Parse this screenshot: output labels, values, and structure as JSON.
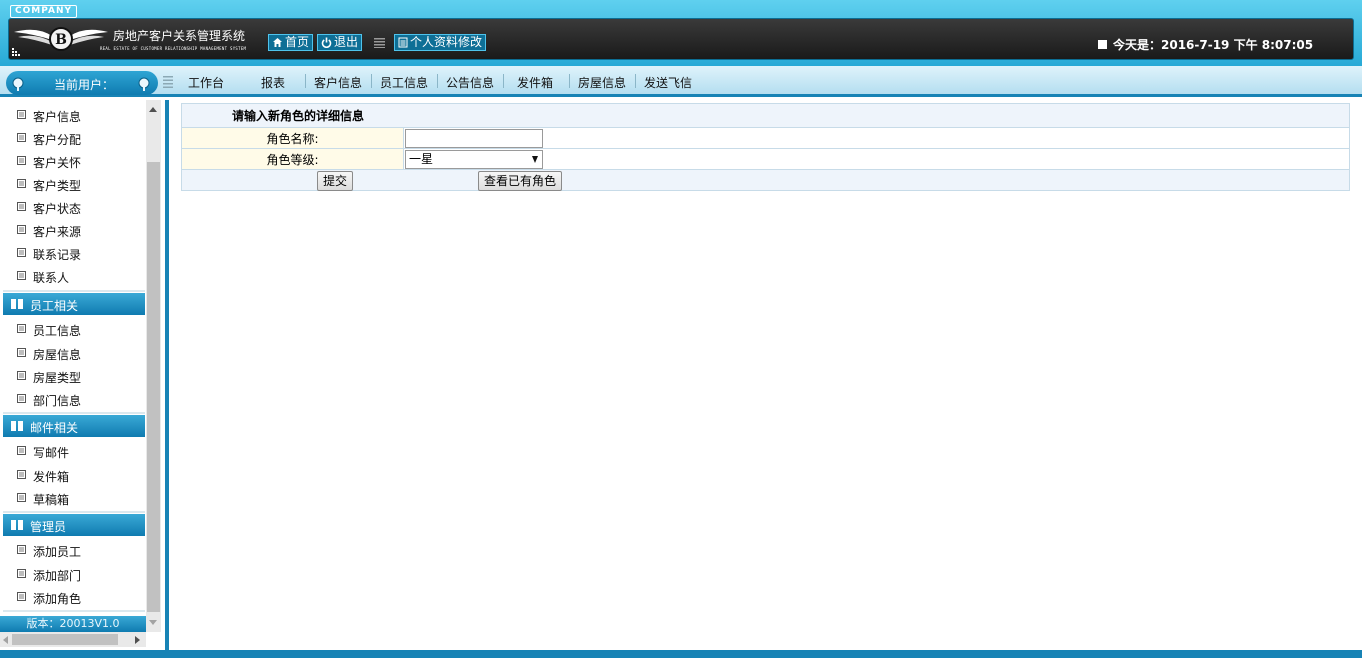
{
  "header": {
    "company": "COMPANY",
    "title": "房地产客户关系管理系统",
    "subtitle": "REAL ESTATE OF CUSTOMER RELATIONSHIP MANAGEMENT SYSTEM",
    "home_label": "首页",
    "logout_label": "退出",
    "profile_label": "个人资料修改",
    "date_text": "今天是：2016-7-19 下午 8:07:05",
    "icons": {
      "home": "home-icon",
      "logout": "power-icon",
      "profile": "document-icon",
      "logo": "winged-b-logo"
    }
  },
  "nav": {
    "current_user_label": "当前用户：",
    "items": [
      "工作台",
      "报表",
      "客户信息",
      "员工信息",
      "公告信息",
      "发件箱",
      "房屋信息",
      "发送飞信"
    ]
  },
  "sidebar": {
    "customer_items": [
      "客户信息",
      "客户分配",
      "客户关怀",
      "客户类型",
      "客户状态",
      "客户来源",
      "联系记录",
      "联系人"
    ],
    "employee_section": {
      "title": "员工相关",
      "items": [
        "员工信息",
        "房屋信息",
        "房屋类型",
        "部门信息"
      ]
    },
    "mail_section": {
      "title": "邮件相关",
      "items": [
        "写邮件",
        "发件箱",
        "草稿箱"
      ]
    },
    "admin_section": {
      "title": "管理员",
      "items": [
        "添加员工",
        "添加部门",
        "添加角色"
      ]
    },
    "version": "版本：20013V1.0"
  },
  "form": {
    "title": "请输入新角色的详细信息",
    "role_name_label": "角色名称:",
    "role_name_value": "",
    "role_level_label": "角色等级:",
    "role_level_selected": "一星",
    "submit_label": "提交",
    "view_roles_label": "查看已有角色"
  },
  "colors": {
    "header_accent": "#27a9d6",
    "dark_band": "#1a1a1a",
    "section_blue": "#0f7bb0",
    "label_bg": "#fffbe8",
    "title_row_bg": "#eef4fb"
  }
}
